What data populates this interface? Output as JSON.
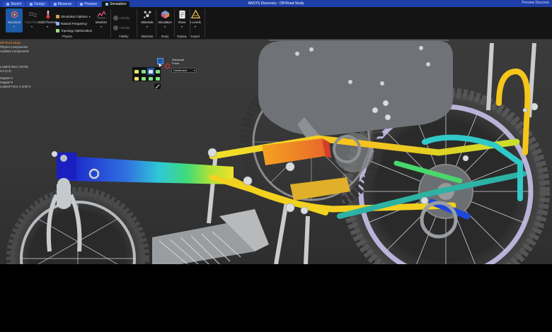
{
  "window": {
    "title": "ANSYS Discovery - Off-Road Study",
    "controls": "Preview  Discover"
  },
  "tabs": [
    {
      "label": "Sketch",
      "active": false
    },
    {
      "label": "Design",
      "active": false
    },
    {
      "label": "Measure",
      "active": false
    },
    {
      "label": "Prepare",
      "active": false
    },
    {
      "label": "Simulation",
      "active": true
    }
  ],
  "ribbon": {
    "structural": "Structural",
    "fluid_flow": "Fluid Flow",
    "solid_thermal": "Solid Thermal",
    "simulation_options": "Simulation Options",
    "natural_frequency": "Natural Frequency",
    "topology_optimization": "Topology Optimization",
    "monitors": "Monitors",
    "physics_group": "Physics",
    "fidelity_a": "Fidelity",
    "fidelity_b": "Fidelity",
    "fidelity_group": "Fidelity",
    "materials": "Materials",
    "materials_group": "Materials",
    "simulation": "Simulation",
    "study_group": "Study",
    "show": "Show",
    "display_group": "Display",
    "export_label": "1 Levels",
    "export_group": "Export"
  },
  "tree": {
    "title": "Off-Road Study",
    "items": [
      "Physics Components",
      "Auxiliary Components"
    ],
    "details": [
      "Loaded Steel, S275N",
      "3.6 (4.4)",
      "Support 3",
      "Support 8",
      "Loaded Force 4   110k N"
    ]
  },
  "force_popup": {
    "line1": "Structural",
    "line2": "Force",
    "dropdown_value": "Distributed"
  },
  "icons": {
    "structural": "structural-sim-icon",
    "fluid": "fluid-flow-icon",
    "thermal": "thermometer-icon",
    "monitor": "monitors-icon",
    "materials": "materials-cube-icon",
    "simulation": "simulation-cube-icon",
    "show": "document-show-icon",
    "export": "export-icon"
  },
  "colors": {
    "titlebar": "#1f3fa8",
    "ribbon": "#141414",
    "selected": "#1d5aa8",
    "tree_title": "#ff8a2b",
    "viewport": "#3a3a3a"
  }
}
